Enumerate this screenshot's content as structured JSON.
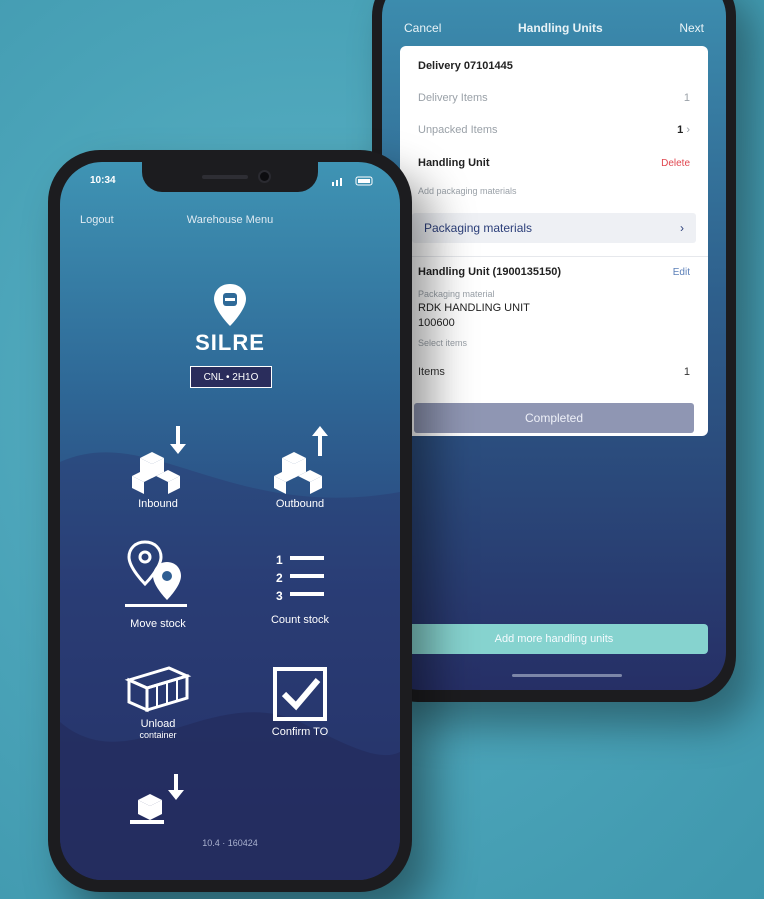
{
  "back_screen": {
    "nav": {
      "cancel": "Cancel",
      "title": "Handling Units",
      "next": "Next"
    },
    "delivery_label": "Delivery 07101445",
    "delivery_items_label": "Delivery Items",
    "delivery_items_value": "1",
    "unpacked_items_label": "Unpacked Items",
    "unpacked_items_value": "1",
    "handling_unit_label": "Handling Unit",
    "delete_label": "Delete",
    "add_packaging_hint": "Add packaging materials",
    "packaging_select_label": "Packaging materials",
    "hu_id_label": "Handling Unit (1900135150)",
    "edit_label": "Edit",
    "packaging_material_label": "Packaging material",
    "packaging_material_value": "RDK HANDLING UNIT",
    "packaging_material_code": "100600",
    "select_items_label": "Select items",
    "items_label": "Items",
    "items_value": "1",
    "completed_button": "Completed",
    "add_more_button": "Add more handling units"
  },
  "front_screen": {
    "status_time": "10:34",
    "nav": {
      "logout": "Logout",
      "title": "Warehouse Menu"
    },
    "brand": "SILRE",
    "badge": "CNL • 2H1O",
    "tiles": {
      "inbound": "Inbound",
      "outbound": "Outbound",
      "move_stock": "Move stock",
      "count_stock": "Count stock",
      "unload_container_line1": "Unload",
      "unload_container_line2": "container",
      "confirm_to": "Confirm TO"
    },
    "version": "10.4 · 160424"
  },
  "colors": {
    "background": "#4aa3b8",
    "delete": "#e0464f",
    "add_button": "#86d3cf",
    "completed_button": "#8f96b3"
  }
}
